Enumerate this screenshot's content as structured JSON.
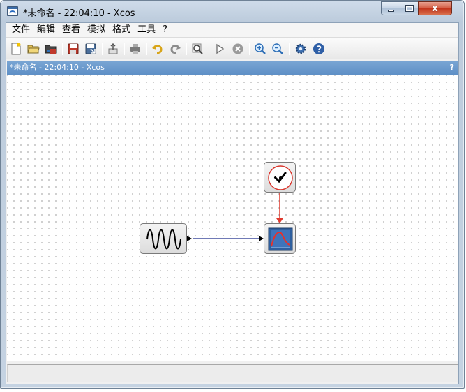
{
  "window": {
    "title": "*未命名 - 22:04:10 - Xcos",
    "close_glyph": "x"
  },
  "menubar": {
    "items": [
      "文件",
      "编辑",
      "查看",
      "模拟",
      "格式",
      "工具",
      "?"
    ]
  },
  "toolbar": {
    "buttons": [
      "new-diagram",
      "open",
      "open-in-scilab",
      "save",
      "save-as",
      "export",
      "print",
      "undo",
      "redo",
      "zoom-fit",
      "start",
      "stop",
      "zoom-in",
      "zoom-out",
      "settings",
      "help"
    ]
  },
  "document": {
    "tab_title": "*未命名 - 22:04:10 - Xcos",
    "help_glyph": "?"
  },
  "diagram": {
    "blocks": [
      {
        "id": "clock",
        "kind": "CLOCK_c"
      },
      {
        "id": "sine",
        "kind": "GENSIN_f"
      },
      {
        "id": "scope",
        "kind": "CSCOPE"
      }
    ],
    "links": [
      {
        "from": "clock",
        "to": "scope",
        "type": "activation",
        "color": "#e03a2f"
      },
      {
        "from": "sine",
        "to": "scope",
        "type": "regular",
        "color": "#1b2a8a"
      }
    ]
  },
  "colors": {
    "title_accent": "#5e8fc6",
    "activation_link": "#e03a2f",
    "regular_link": "#1b2a8a",
    "close_button": "#c2341b"
  }
}
